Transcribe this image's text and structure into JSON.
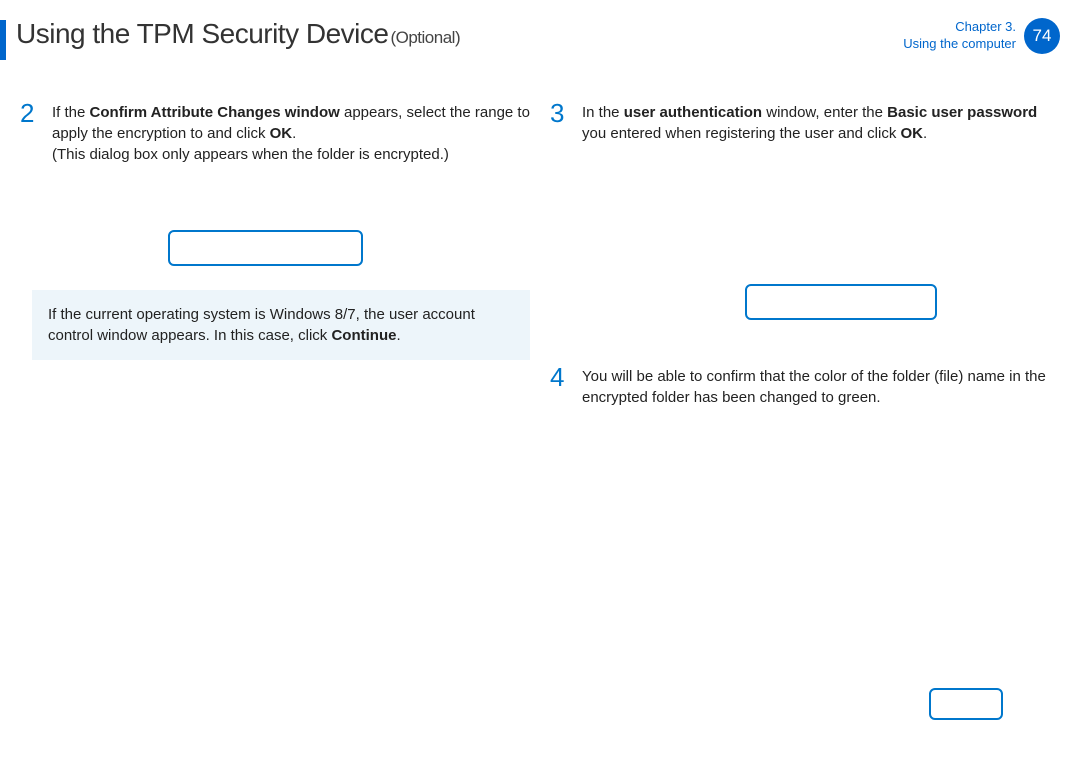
{
  "header": {
    "title": "Using the TPM Security Device",
    "optional": "(Optional)",
    "chapter": "Chapter 3.",
    "section": "Using the computer",
    "page": "74"
  },
  "steps": {
    "s2": {
      "num": "2",
      "t1": "If the ",
      "b1": "Conﬁrm Attribute Changes window",
      "t2": " appears, select the range to apply the encryption to and click ",
      "b2": "OK",
      "t3": ".",
      "note": "(This dialog box only appears when the folder is encrypted.)"
    },
    "s3": {
      "num": "3",
      "t1": "In the ",
      "b1": "user authentication",
      "t2": " window, enter the ",
      "b2": "Basic user password",
      "t3": " you entered when registering the user and click ",
      "b3": "OK",
      "t4": "."
    },
    "s4": {
      "num": "4",
      "text": "You will be able to conﬁrm that the color of the folder (ﬁle) name in the encrypted folder has been changed to green."
    }
  },
  "info": {
    "t1": "If the current operating system is Windows 8/7, the user account control window appears. In this case, click ",
    "b1": "Continue",
    "t2": "."
  }
}
